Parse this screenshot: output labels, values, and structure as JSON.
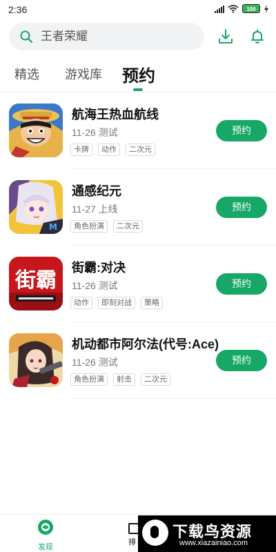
{
  "status_bar": {
    "time": "2:36",
    "battery": "100"
  },
  "search": {
    "text": "王者荣耀"
  },
  "tabs": [
    {
      "label": "精选"
    },
    {
      "label": "游戏库"
    },
    {
      "label": "预约"
    }
  ],
  "games": [
    {
      "title": "航海王热血航线",
      "date": "11-26 测试",
      "tags": [
        "卡牌",
        "动作",
        "二次元"
      ],
      "button": "预约"
    },
    {
      "title": "通感纪元",
      "date": "11-27 上线",
      "tags": [
        "角色扮演",
        "二次元"
      ],
      "button": "预约"
    },
    {
      "title": "街霸:对决",
      "date": "11-26 测试",
      "tags": [
        "动作",
        "即刻对战",
        "策略"
      ],
      "button": "预约",
      "icon_text": "街霸"
    },
    {
      "title": "机动都市阿尔法(代号:Ace)",
      "date": "11-26 测试",
      "tags": [
        "角色扮演",
        "射击",
        "二次元"
      ],
      "button": "预约"
    }
  ],
  "bottom_nav": {
    "discover": "发现",
    "rank": "排"
  },
  "watermark": {
    "title": "下载鸟资源",
    "url": "www.xiazainiao.com"
  },
  "colors": {
    "accent": "#17a766",
    "search_bg": "#f2f3f5"
  },
  "icons": [
    "search-icon",
    "download-icon",
    "bell-icon",
    "discover-icon"
  ]
}
